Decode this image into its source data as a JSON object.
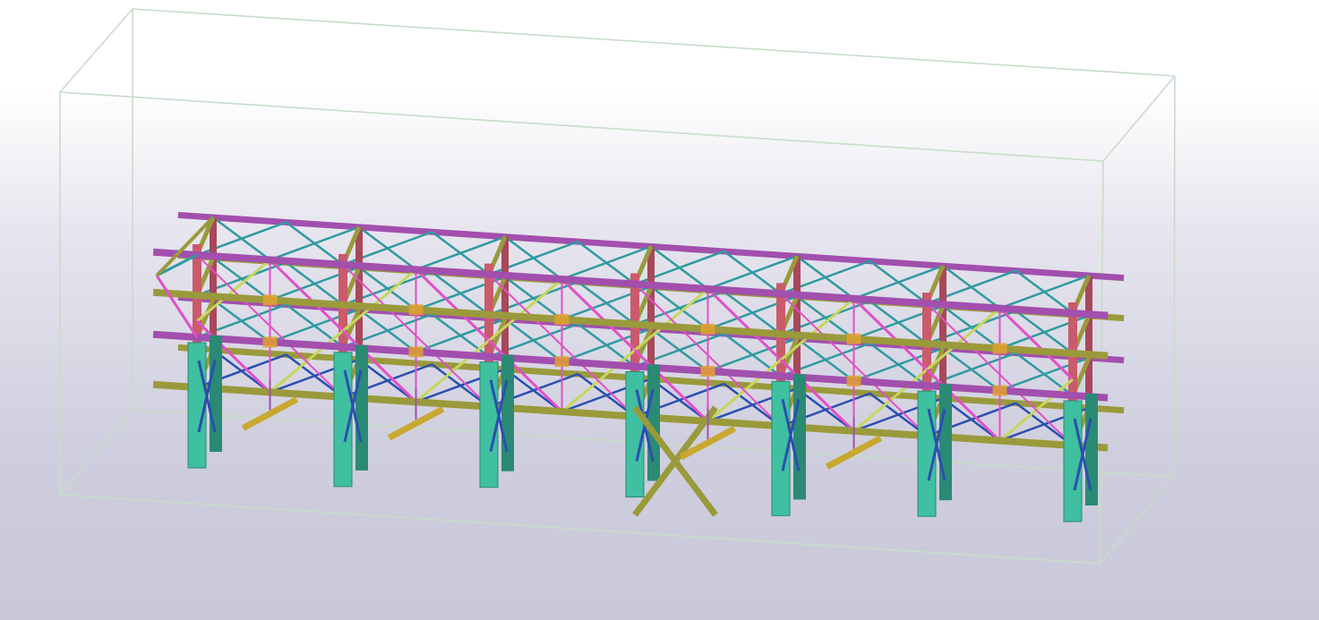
{
  "viewport": {
    "background_top": "#ffffff",
    "background_bottom": "#c9c8d8"
  },
  "model": {
    "bays": 6,
    "levels": 3,
    "colors": {
      "column": "#c95b6b",
      "column_dark": "#a8485a",
      "beam_long": "#a24fae",
      "beam_olive": "#9a9a3c",
      "brace_pink": "#e24fc8",
      "brace_lime": "#c5d85a",
      "brace_teal": "#2f9aa0",
      "brace_blue": "#2a4fb0",
      "pedestal": "#3fc0a0",
      "pedestal_dark": "#2a8a74",
      "plate": "#e0a030",
      "hanger_bar": "#c8a830",
      "bbox": "#c8dcc8"
    }
  }
}
